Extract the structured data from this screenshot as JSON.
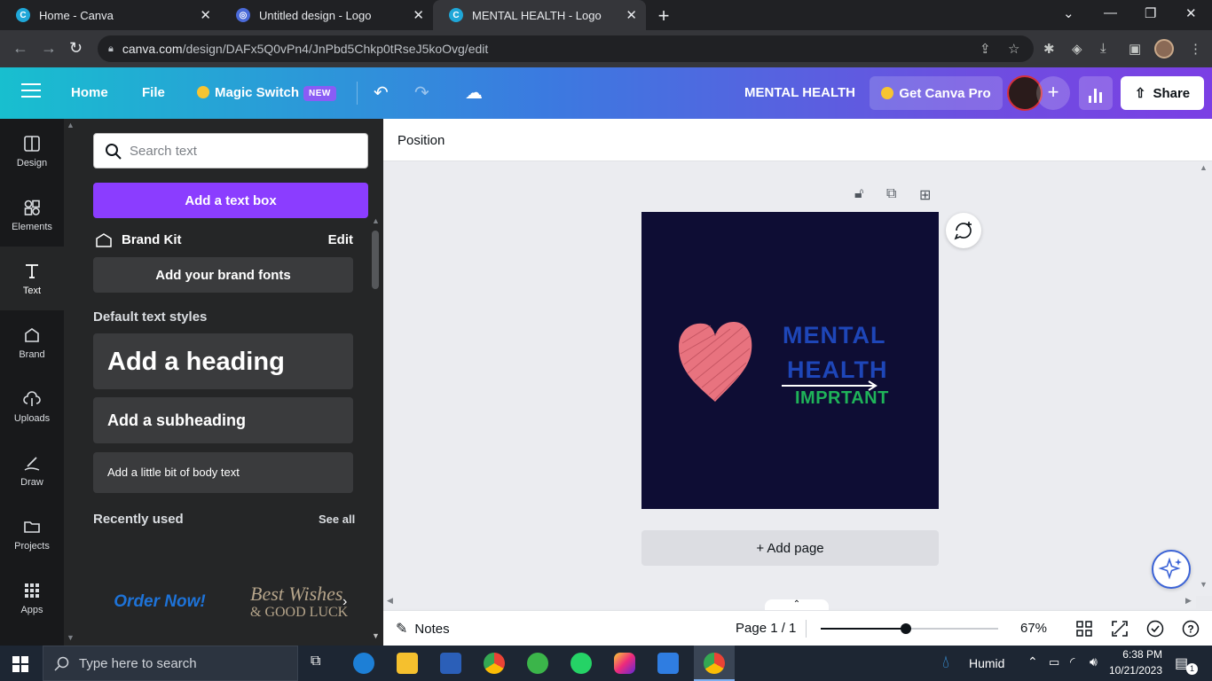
{
  "browser": {
    "tabs": [
      {
        "title": "Home - Canva",
        "active": false
      },
      {
        "title": "Untitled design - Logo",
        "active": false
      },
      {
        "title": "MENTAL HEALTH - Logo",
        "active": true
      }
    ],
    "url_host": "canva.com",
    "url_path": "/design/DAFx5Q0vPn4/JnPbd5Chkp0tRseJ5koOvg/edit"
  },
  "topbar": {
    "home": "Home",
    "file": "File",
    "magic_switch": "Magic Switch",
    "new_badge": "NEW",
    "design_title": "MENTAL HEALTH",
    "get_pro": "Get Canva Pro",
    "share": "Share",
    "gradient": [
      "#18bfcf",
      "#3b7ae0",
      "#7b3fe4"
    ]
  },
  "rail": [
    {
      "label": "Design",
      "icon": "design-icon"
    },
    {
      "label": "Elements",
      "icon": "elements-icon"
    },
    {
      "label": "Text",
      "icon": "text-icon",
      "active": true
    },
    {
      "label": "Brand",
      "icon": "brand-icon"
    },
    {
      "label": "Uploads",
      "icon": "uploads-icon"
    },
    {
      "label": "Draw",
      "icon": "draw-icon"
    },
    {
      "label": "Projects",
      "icon": "projects-icon"
    },
    {
      "label": "Apps",
      "icon": "apps-icon"
    }
  ],
  "panel": {
    "search_placeholder": "Search text",
    "add_textbox": "Add a text box",
    "brand_kit": "Brand Kit",
    "brand_edit": "Edit",
    "add_brand_fonts": "Add your brand fonts",
    "default_styles": "Default text styles",
    "heading": "Add a heading",
    "subheading": "Add a subheading",
    "body": "Add a little bit of body text",
    "recently_used": "Recently used",
    "see_all": "See all",
    "recent_1": "Order Now!",
    "recent_2a": "Best Wishes",
    "recent_2b": "& GOOD LUCK",
    "accent": "#8b3dff"
  },
  "context_bar": {
    "position": "Position"
  },
  "design": {
    "line1": "MENTAL",
    "line2": "HEALTH",
    "line3": "IMPRTANT",
    "bg": "#0e0d34",
    "heading_color": "#1e46b8",
    "sub_color": "#1fb359",
    "heart_color": "#e8737f"
  },
  "add_page": "+ Add page",
  "bottombar": {
    "notes": "Notes",
    "page": "Page 1 / 1",
    "zoom": "67%",
    "zoom_level": 0.48
  },
  "taskbar": {
    "search": "Type here to search",
    "weather": "Humid",
    "time": "6:38 PM",
    "date": "10/21/2023",
    "notifications": "1"
  }
}
